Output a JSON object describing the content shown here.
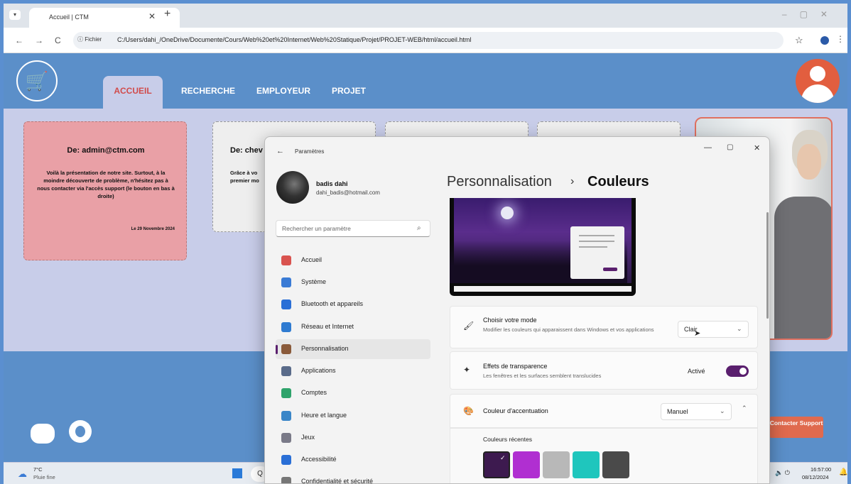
{
  "browser": {
    "tab_title": "Accueil | CTM",
    "tab_close": "✕",
    "new_tab": "+",
    "window_controls": "–▢✕",
    "back": "←",
    "forward": "→",
    "reload": "C",
    "file_chip": "ⓘ Fichier",
    "url": "C:/Users/dahi_/OneDrive/Documente/Cours/Web%20et%20Internet/Web%20Statique/Projet/PROJET-WEB/html/accueil.html",
    "star": "☆",
    "menu": "⋮"
  },
  "site": {
    "logo": "🛒",
    "nav": [
      "ACCUEIL",
      "RECHERCHE",
      "EMPLOYEUR",
      "PROJET"
    ],
    "card1": {
      "from": "De: admin@ctm.com",
      "body": "Voilà la présentation de notre site. Surtout, à la moindre découverte de problème, n'hésitez pas à nous contacter via l'accès support (le bouton en bas à droite)",
      "date": "Le 29 Novembre 2024"
    },
    "card2": {
      "from": "De: chev",
      "body": "Grâce à vo\npremier mo"
    },
    "support": "Contacter Support",
    "colors": {
      "header": "#5b8fc9",
      "accent": "#d14b4b",
      "support": "#e06a4e",
      "card_pink": "#e9a0a6"
    }
  },
  "taskbar": {
    "temp": "7°C",
    "weather": "Pluie fine",
    "search": "Q",
    "time": "16:57:00",
    "date": "08/12/2024"
  },
  "settings": {
    "title": "Paramètres",
    "back": "←",
    "user_name": "badis dahi",
    "user_email": "dahi_badis@hotmail.com",
    "search_placeholder": "Rechercher un paramètre",
    "nav": [
      {
        "label": "Accueil",
        "icon": "home-icon",
        "color": "#d9534f"
      },
      {
        "label": "Système",
        "icon": "monitor-icon",
        "color": "#3a7bd5"
      },
      {
        "label": "Bluetooth et appareils",
        "icon": "bluetooth-icon",
        "color": "#2a6fd6"
      },
      {
        "label": "Réseau et Internet",
        "icon": "wifi-icon",
        "color": "#2f7bd1"
      },
      {
        "label": "Personnalisation",
        "icon": "brush-icon",
        "color": "#8a5a3a"
      },
      {
        "label": "Applications",
        "icon": "apps-icon",
        "color": "#5a6b8a"
      },
      {
        "label": "Comptes",
        "icon": "person-icon",
        "color": "#2fa36b"
      },
      {
        "label": "Heure et langue",
        "icon": "globe-icon",
        "color": "#3a86c8"
      },
      {
        "label": "Jeux",
        "icon": "gamepad-icon",
        "color": "#7a7a88"
      },
      {
        "label": "Accessibilité",
        "icon": "accessibility-icon",
        "color": "#2a6fd6"
      },
      {
        "label": "Confidentialité et sécurité",
        "icon": "shield-icon",
        "color": "#777"
      }
    ],
    "breadcrumb_parent": "Personnalisation",
    "breadcrumb_sep": "›",
    "breadcrumb_current": "Couleurs",
    "mode": {
      "title": "Choisir votre mode",
      "desc": "Modifier les couleurs qui apparaissent dans Windows et vos applications",
      "value": "Clair"
    },
    "transparency": {
      "title": "Effets de transparence",
      "desc": "Les fenêtres et les surfaces semblent translucides",
      "state": "Activé",
      "on": true
    },
    "accent": {
      "title": "Couleur d'accentuation",
      "value": "Manuel"
    },
    "recent": {
      "title": "Couleurs récentes",
      "colors": [
        "#3d1a4f",
        "#b02fd1",
        "#b8b8b8",
        "#1fc6bd",
        "#4a4a4a"
      ]
    }
  }
}
